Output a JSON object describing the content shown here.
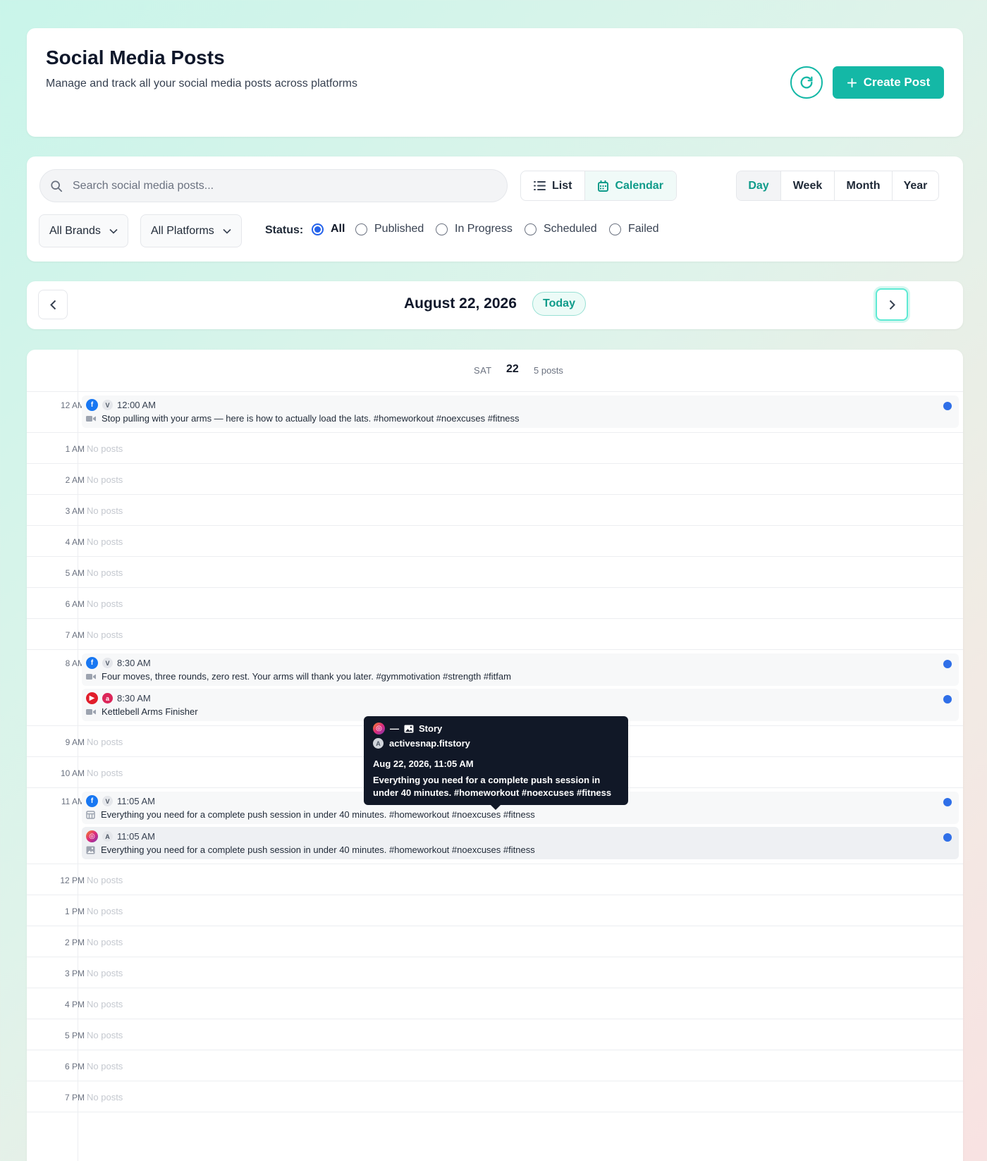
{
  "header": {
    "title": "Social Media Posts",
    "subtitle": "Manage and track all your social media posts across platforms",
    "create_label": "Create Post",
    "accent_color": "#14b8a6"
  },
  "filters": {
    "search_placeholder": "Search social media posts...",
    "view_list": "List",
    "view_calendar": "Calendar",
    "ranges": [
      "Day",
      "Week",
      "Month",
      "Year"
    ],
    "brand_select": "All Brands",
    "platform_select": "All Platforms",
    "status_label": "Status:",
    "statuses": [
      "All",
      "Published",
      "In Progress",
      "Scheduled",
      "Failed"
    ],
    "selected_status": "All"
  },
  "nav": {
    "date": "August 22, 2026",
    "today_label": "Today"
  },
  "day": {
    "weekday": "SAT",
    "day_num": "22",
    "post_count": "5 posts"
  },
  "no_posts_text": "No posts",
  "hours": [
    "12 AM",
    "1 AM",
    "2 AM",
    "3 AM",
    "4 AM",
    "5 AM",
    "6 AM",
    "7 AM",
    "8 AM",
    "9 AM",
    "10 AM",
    "11 AM",
    "12 PM",
    "1 PM",
    "2 PM",
    "3 PM",
    "4 PM",
    "5 PM",
    "6 PM",
    "7 PM"
  ],
  "posts": [
    {
      "hour": "12 AM",
      "platform": "facebook",
      "avatar": "V",
      "time": "12:00 AM",
      "media": "video",
      "text": "Stop pulling with your arms — here is how to actually load the lats. #homeworkout #noexcuses #fitness"
    },
    {
      "hour": "8 AM",
      "platform": "facebook",
      "avatar": "V",
      "time": "8:30 AM",
      "media": "video",
      "text": "Four moves, three rounds, zero rest. Your arms will thank you later. #gymmotivation #strength #fitfam"
    },
    {
      "hour": "8 AM",
      "platform": "youtube",
      "avatar": "a",
      "time": "8:30 AM",
      "media": "video",
      "text": "Kettlebell Arms Finisher"
    },
    {
      "hour": "11 AM",
      "platform": "facebook",
      "avatar": "V",
      "time": "11:05 AM",
      "media": "carousel",
      "text": "Everything you need for a complete push session in under 40 minutes. #homeworkout #noexcuses #fitness"
    },
    {
      "hour": "11 AM",
      "platform": "instagram",
      "avatar": "A",
      "time": "11:05 AM",
      "media": "image",
      "text": "Everything you need for a complete push session in under 40 minutes. #homeworkout #noexcuses #fitness"
    }
  ],
  "tooltip": {
    "separator": "—",
    "type": "Story",
    "avatar": "A",
    "account": "activesnap.fitstory",
    "datetime": "Aug 22, 2026, 11:05 AM",
    "text": "Everything you need for a complete push session in under 40 minutes. #homeworkout #noexcuses #fitness"
  },
  "status_dot_color": "#2f6fe8"
}
